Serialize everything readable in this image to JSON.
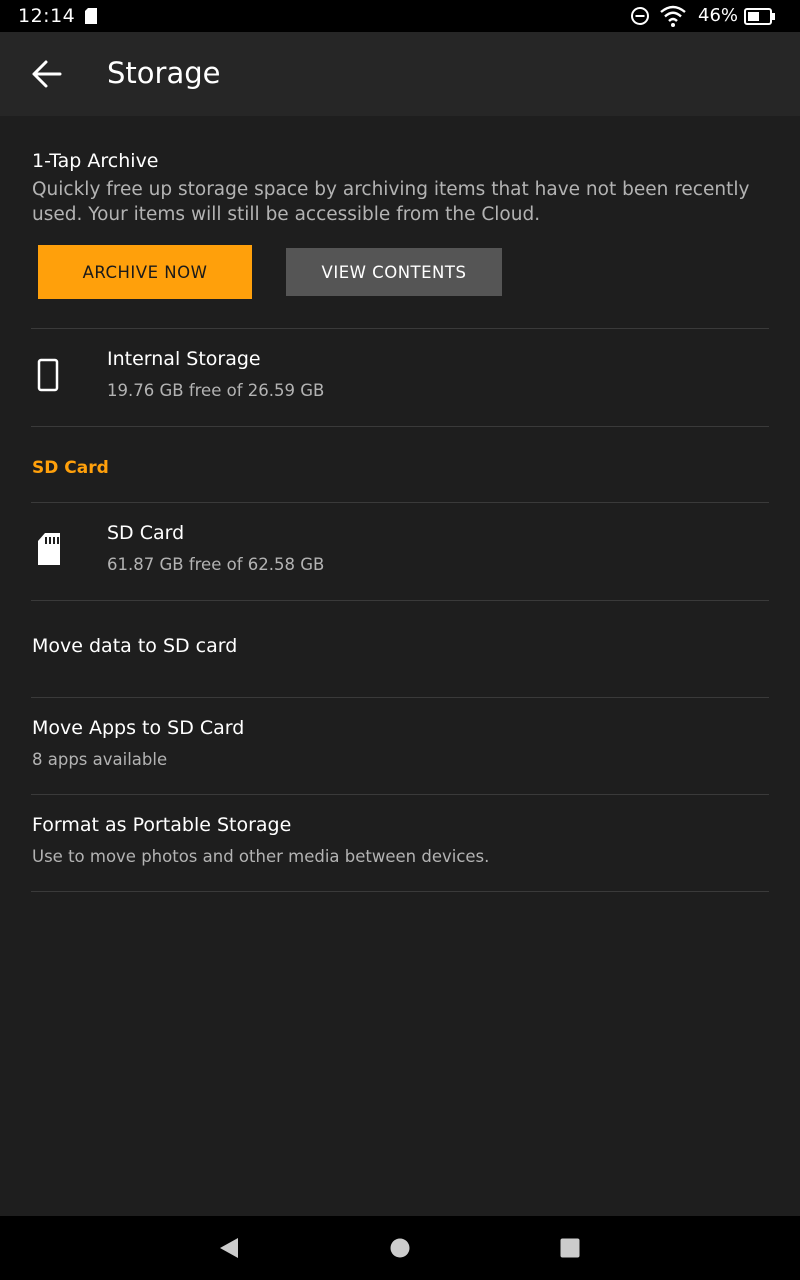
{
  "status_bar": {
    "time": "12:14",
    "battery_percent": "46%",
    "icons": [
      "sd-card-icon",
      "do-not-disturb-icon",
      "wifi-icon",
      "battery-icon"
    ]
  },
  "app_bar": {
    "title": "Storage",
    "back_icon": "arrow-left-icon"
  },
  "archive": {
    "title": "1-Tap Archive",
    "description": "Quickly free up storage space by archiving items that have not been recently used. Your items will still be accessible from the Cloud.",
    "archive_button": "ARCHIVE NOW",
    "view_button": "VIEW CONTENTS"
  },
  "internal_storage": {
    "icon": "phone-icon",
    "title": "Internal Storage",
    "subtitle": "19.76 GB free of 26.59 GB"
  },
  "sd_section": {
    "header": "SD Card",
    "card": {
      "icon": "sd-card-icon",
      "title": "SD Card",
      "subtitle": "61.87 GB free of 62.58 GB"
    },
    "move_data": {
      "title": "Move data to SD card"
    },
    "move_apps": {
      "title": "Move Apps to SD Card",
      "subtitle": "8 apps available"
    },
    "format": {
      "title": "Format as Portable Storage",
      "subtitle": "Use to move photos and other media between devices."
    }
  },
  "colors": {
    "accent": "#ffa00b",
    "background": "#1e1e1e",
    "app_bar": "#262626",
    "secondary_button": "#555555",
    "secondary_text": "#b3b3b3"
  },
  "nav_bar": {
    "icons": [
      "back-triangle-icon",
      "home-circle-icon",
      "recents-square-icon"
    ]
  }
}
